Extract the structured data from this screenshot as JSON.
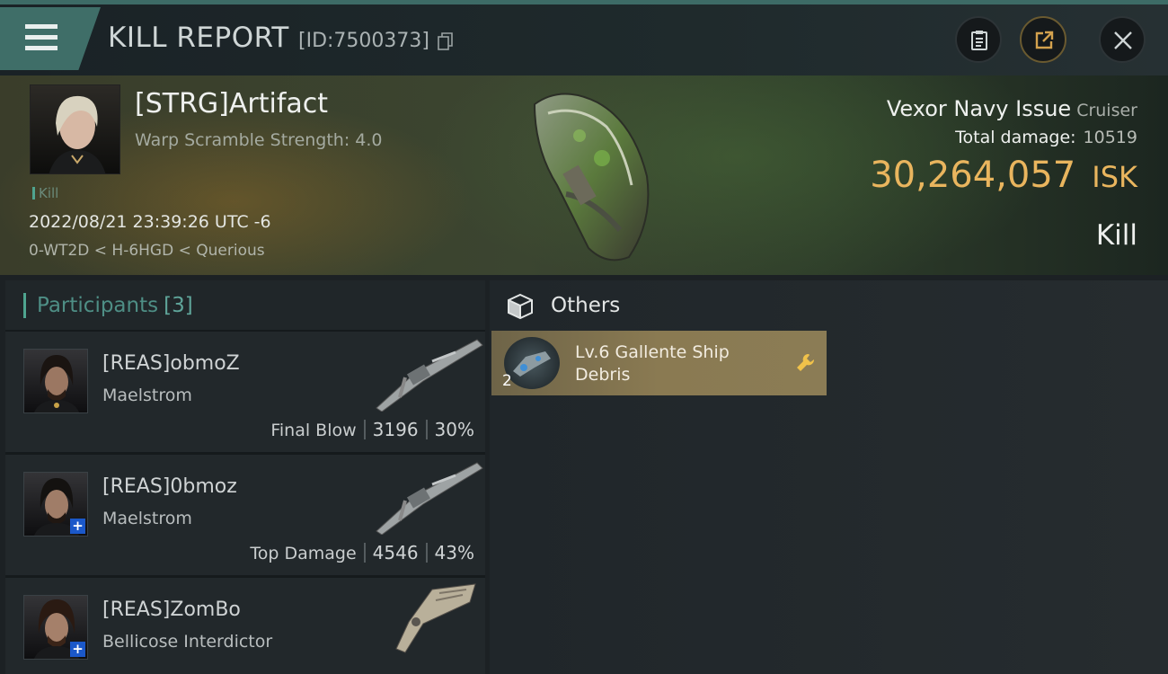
{
  "header": {
    "title": "KILL REPORT",
    "report_id": "[ID:7500373]"
  },
  "pilot": {
    "name": "[STRG]Artifact",
    "warp_scramble": "Warp Scramble Strength: 4.0",
    "tag": "Kill",
    "datetime": "2022/08/21 23:39:26 UTC -6",
    "location": "0-WT2D < H-6HGD < Querious"
  },
  "victim": {
    "ship_name": "Vexor Navy Issue",
    "ship_class": "Cruiser",
    "total_damage_label": "Total damage:",
    "total_damage": "10519",
    "isk_value": "30,264,057",
    "isk_unit": "ISK",
    "result": "Kill"
  },
  "participants": {
    "title": "Participants",
    "count": "[3]",
    "rows": [
      {
        "name": "[REAS]obmoZ",
        "ship": "Maelstrom",
        "label": "Final Blow",
        "damage": "3196",
        "percent": "30%"
      },
      {
        "name": "[REAS]0bmoz",
        "ship": "Maelstrom",
        "label": "Top Damage",
        "damage": "4546",
        "percent": "43%"
      },
      {
        "name": "[REAS]ZomBo",
        "ship": "Bellicose Interdictor"
      }
    ]
  },
  "others": {
    "title": "Others",
    "items": [
      {
        "name": "Lv.6 Gallente Ship Debris",
        "quantity": "2"
      }
    ]
  },
  "colors": {
    "accent_teal": "#3f6e68",
    "isk_gold": "#e9b55e",
    "item_card": "#8a7a52"
  },
  "icons": [
    "menu-icon",
    "copy-icon",
    "clipboard-icon",
    "share-icon",
    "close-icon",
    "box-icon",
    "wrench-icon"
  ]
}
